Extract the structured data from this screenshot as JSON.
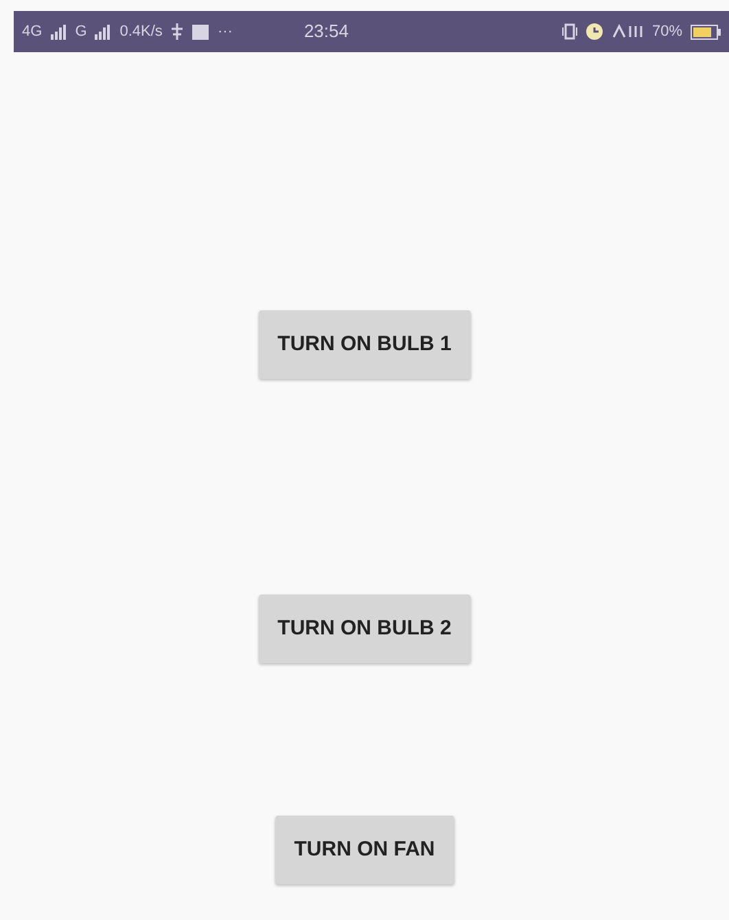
{
  "status_bar": {
    "network_1": "4G",
    "network_2": "G",
    "speed": "0.4K/s",
    "more": "···",
    "time": "23:54",
    "battery": "70%"
  },
  "buttons": [
    {
      "label": "TURN ON BULB 1"
    },
    {
      "label": "TURN ON BULB 2"
    },
    {
      "label": "TURN ON FAN"
    }
  ]
}
